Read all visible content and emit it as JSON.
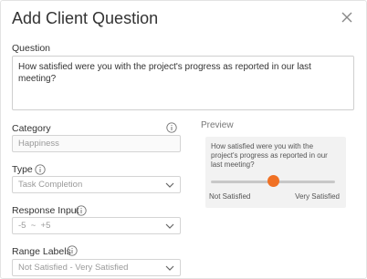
{
  "dialog": {
    "title": "Add Client Question"
  },
  "question": {
    "label": "Question",
    "value": "How satisfied were you with the project's progress as reported in our last meeting?"
  },
  "category": {
    "label": "Category",
    "value": "Happiness",
    "disabled": true
  },
  "type": {
    "label": "Type",
    "value": "Task Completion"
  },
  "response_input": {
    "label": "Response Input",
    "value": "-5  ~  +5"
  },
  "range_labels": {
    "label": "Range Labels",
    "value": "Not Satisfied - Very Satisfied"
  },
  "preview": {
    "label": "Preview",
    "question": "How satisfied were you with the project's progress as reported in our last meeting?",
    "min_label": "Not Satisfied",
    "max_label": "Very Satisfied",
    "slider_fraction": 0.5
  },
  "colors": {
    "accent": "#f07124",
    "preview_bg": "#f2f2f2"
  },
  "icons": [
    "close-icon",
    "info-icon",
    "chevron-down-icon"
  ]
}
